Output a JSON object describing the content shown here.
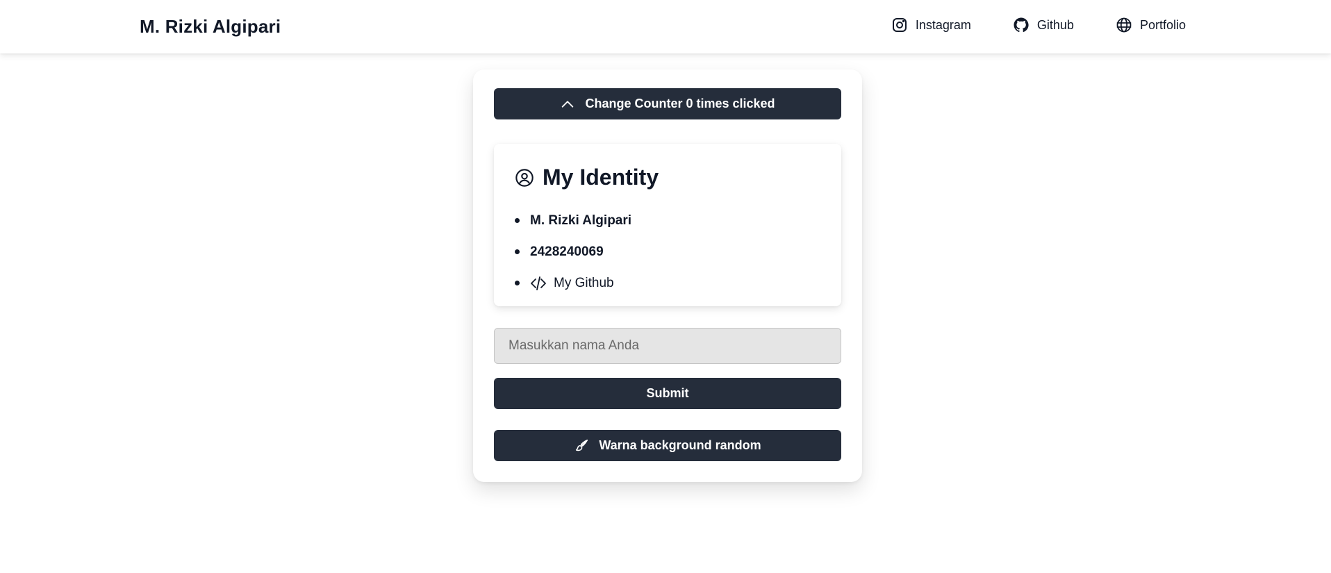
{
  "navbar": {
    "brand": "M. Rizki Algipari",
    "links": [
      {
        "label": "Instagram",
        "icon": "instagram-icon"
      },
      {
        "label": "Github",
        "icon": "github-icon"
      },
      {
        "label": "Portfolio",
        "icon": "globe-icon"
      }
    ]
  },
  "card": {
    "counter_button": {
      "label": "Change Counter 0 times clicked",
      "icon": "chevron-up-icon"
    },
    "identity": {
      "title": "My Identity",
      "icon": "user-circle-icon",
      "items": {
        "name": "M. Rizki Algipari",
        "id": "2428240069",
        "github_link": {
          "label": "My Github",
          "icon": "code-icon"
        }
      }
    },
    "name_input": {
      "placeholder": "Masukkan nama Anda",
      "value": ""
    },
    "submit_button": {
      "label": "Submit"
    },
    "random_bg_button": {
      "label": "Warna background random",
      "icon": "paintbrush-icon"
    }
  },
  "colors": {
    "button_bg": "#252d3b",
    "text": "#111827",
    "input_bg": "#e5e5e5"
  }
}
